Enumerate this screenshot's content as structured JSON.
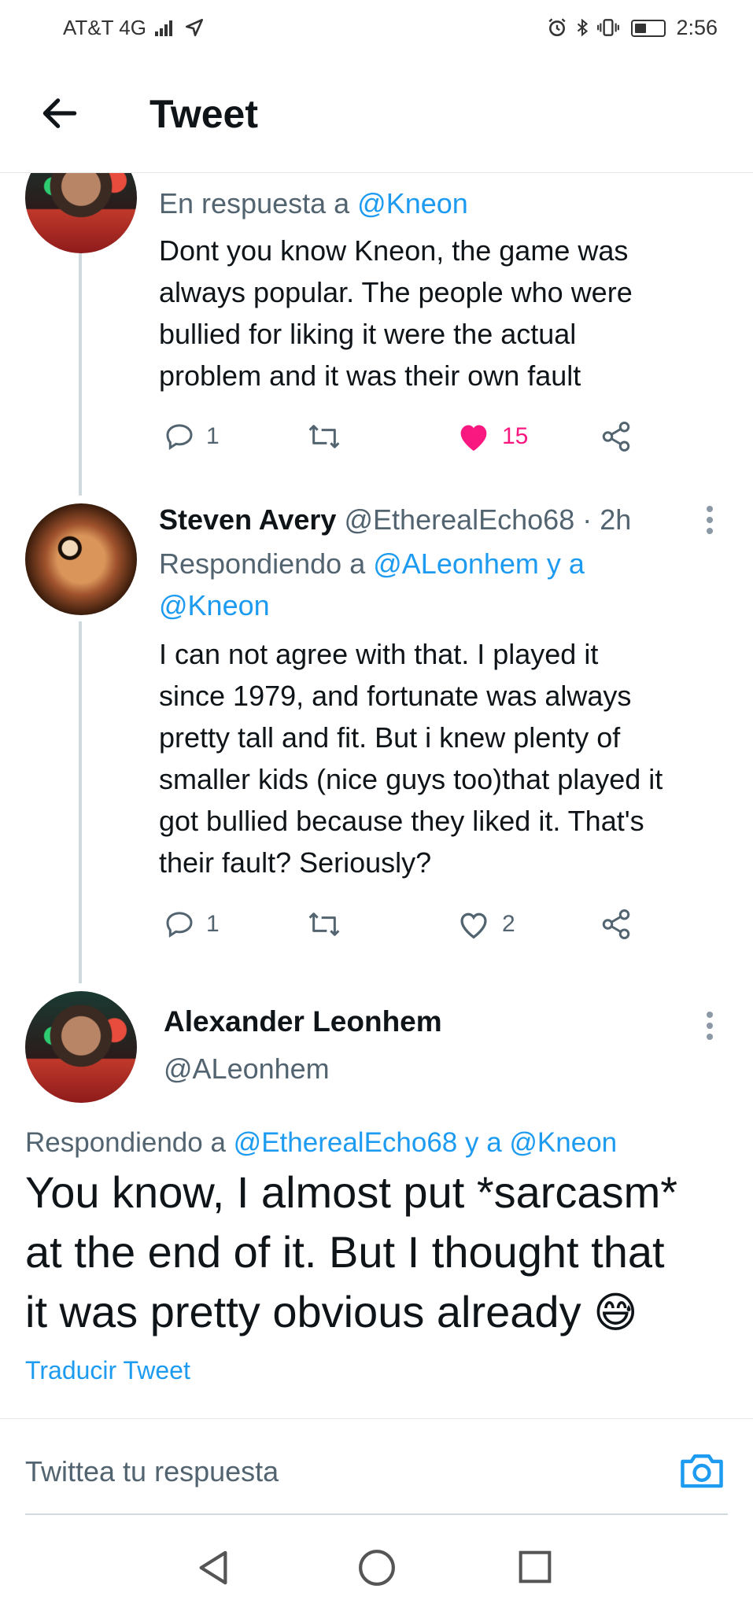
{
  "status_bar": {
    "carrier": "AT&T 4G",
    "network_badge": "4G",
    "time": "2:56",
    "icons": [
      "signal-icon",
      "location-arrow-icon",
      "alarm-icon",
      "bluetooth-icon",
      "vibrate-icon",
      "battery-icon"
    ]
  },
  "header": {
    "title": "Tweet",
    "back_icon": "arrow-left-icon"
  },
  "tweets": [
    {
      "reply_prefix": "En respuesta a",
      "reply_to": "@Kneon",
      "text": [
        "Dont you know Kneon, the game was",
        "always popular. The people who were",
        "bullied for liking it were the actual",
        "problem and it was their own fault"
      ],
      "replies": "1",
      "likes": "15",
      "liked": true
    },
    {
      "name": "Steven Avery",
      "handle": "@EtherealEcho68",
      "sep": "·",
      "time": "2h",
      "reply_prefix": "Respondiendo a",
      "reply_to_line1": "@ALeonhem y a",
      "reply_to_line2": "@Kneon",
      "text": [
        "I can not agree with that. I played it",
        "since 1979, and fortunate was always",
        "pretty tall and fit. But i knew plenty of",
        "smaller kids (nice guys too)that played it",
        "got bullied because they liked it. That's",
        "their fault? Seriously?"
      ],
      "replies": "1",
      "likes": "2",
      "liked": false
    }
  ],
  "main_tweet": {
    "name": "Alexander Leonhem",
    "handle": "@ALeonhem",
    "reply_prefix": "Respondiendo a",
    "reply_to": "@EtherealEcho68 y a @Kneon",
    "text": [
      "You know, I almost put *sarcasm*",
      "at the end of it. But I thought that",
      "it was pretty obvious already"
    ],
    "emoji": "😅",
    "translate": "Traducir Tweet"
  },
  "reply_box": {
    "placeholder": "Twittea tu respuesta",
    "camera_icon": "camera-icon"
  },
  "colors": {
    "accent": "#1d9bf0",
    "like": "#f91880",
    "secondary_text": "#536471",
    "thread_line": "#cfd9de"
  }
}
